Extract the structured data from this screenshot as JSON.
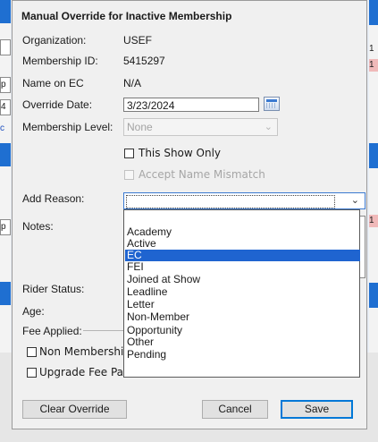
{
  "background": {
    "left_fragments": [
      "p",
      "4",
      "c",
      "p"
    ],
    "right_fragments": [
      "1",
      "1",
      "1"
    ]
  },
  "dialog": {
    "title": "Manual Override for Inactive Membership",
    "fields": {
      "organization": {
        "label": "Organization:",
        "value": "USEF"
      },
      "membership_id": {
        "label": "Membership ID:",
        "value": "5415297"
      },
      "name_on_ec": {
        "label": "Name on EC",
        "value": "N/A"
      },
      "override_date": {
        "label": "Override Date:",
        "value": "3/23/2024"
      },
      "membership_level": {
        "label": "Membership Level:",
        "value": "None"
      }
    },
    "this_show_only": {
      "label": "This Show Only",
      "checked": false
    },
    "accept_name_mismatch": {
      "label": "Accept Name Mismatch",
      "checked": false,
      "disabled": true
    },
    "add_reason": {
      "label": "Add Reason:",
      "value": "",
      "options": [
        "Academy",
        "Active",
        "EC",
        "FEI",
        "Joined at Show",
        "Leadline",
        "Letter",
        "Non-Member",
        "Opportunity",
        "Other",
        "Pending"
      ],
      "highlighted": "EC"
    },
    "notes_label": "Notes:",
    "rider_status_label": "Rider Status:",
    "age_label": "Age:",
    "fee_applied": {
      "label": "Fee Applied:",
      "non_membership": "Non Membership",
      "upgrade_fee_paid": "Upgrade Fee Paid"
    },
    "buttons": {
      "clear_override": "Clear Override",
      "cancel": "Cancel",
      "save": "Save"
    }
  }
}
